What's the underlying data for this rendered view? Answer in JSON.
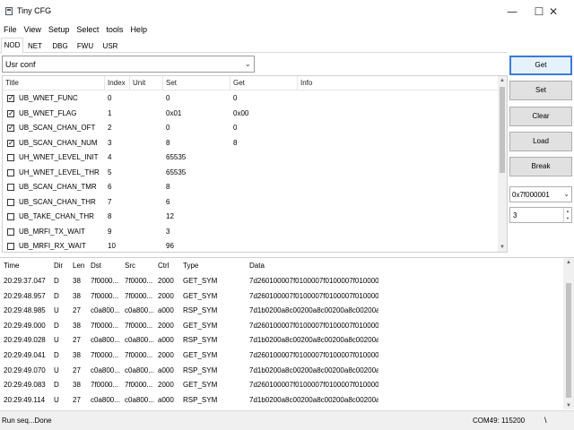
{
  "window": {
    "title": "Tiny CFG",
    "minimize_glyph": "—",
    "maximize_glyph": "☐",
    "close_glyph": "✕"
  },
  "menu": [
    "File",
    "View",
    "Setup",
    "Select",
    "tools",
    "Help"
  ],
  "tabs": [
    {
      "label": "NOD",
      "active": true
    },
    {
      "label": "NET",
      "active": false
    },
    {
      "label": "DBG",
      "active": false
    },
    {
      "label": "FWU",
      "active": false
    },
    {
      "label": "USR",
      "active": false
    }
  ],
  "config_combo": {
    "value": "Usr conf"
  },
  "param_table": {
    "columns": [
      "Title",
      "Index",
      "Unit",
      "Set",
      "Get",
      "Info"
    ],
    "rows": [
      {
        "checked": true,
        "title": "UB_WNET_FUNC",
        "index": "0",
        "unit": "",
        "set": "0",
        "get": "0",
        "info": ""
      },
      {
        "checked": true,
        "title": "UB_WNET_FLAG",
        "index": "1",
        "unit": "",
        "set": "0x01",
        "get": "0x00",
        "info": ""
      },
      {
        "checked": true,
        "title": "UB_SCAN_CHAN_OFT",
        "index": "2",
        "unit": "",
        "set": "0",
        "get": "0",
        "info": ""
      },
      {
        "checked": true,
        "title": "UB_SCAN_CHAN_NUM",
        "index": "3",
        "unit": "",
        "set": "8",
        "get": "8",
        "info": ""
      },
      {
        "checked": false,
        "title": "UH_WNET_LEVEL_INIT",
        "index": "4",
        "unit": "",
        "set": "65535",
        "get": "",
        "info": ""
      },
      {
        "checked": false,
        "title": "UH_WNET_LEVEL_THR",
        "index": "5",
        "unit": "",
        "set": "65535",
        "get": "",
        "info": ""
      },
      {
        "checked": false,
        "title": "UB_SCAN_CHAN_TMR",
        "index": "6",
        "unit": "",
        "set": "8",
        "get": "",
        "info": ""
      },
      {
        "checked": false,
        "title": "UB_SCAN_CHAN_THR",
        "index": "7",
        "unit": "",
        "set": "6",
        "get": "",
        "info": ""
      },
      {
        "checked": false,
        "title": "UB_TAKE_CHAN_THR",
        "index": "8",
        "unit": "",
        "set": "12",
        "get": "",
        "info": ""
      },
      {
        "checked": false,
        "title": "UB_MRFI_TX_WAIT",
        "index": "9",
        "unit": "",
        "set": "3",
        "get": "",
        "info": ""
      },
      {
        "checked": false,
        "title": "UB_MRFI_RX_WAIT",
        "index": "10",
        "unit": "",
        "set": "96",
        "get": "",
        "info": ""
      }
    ]
  },
  "actions": {
    "get": "Get",
    "set": "Set",
    "clear": "Clear",
    "load": "Load",
    "break": "Break",
    "address": "0x7f000001",
    "count": "3"
  },
  "log_table": {
    "columns": [
      "Time",
      "Dir",
      "Len",
      "Dst",
      "Src",
      "Ctrl",
      "Type",
      "Data"
    ],
    "rows": [
      {
        "time": "20:29:37.047",
        "dir": "D",
        "len": "38",
        "dst": "7f0000...",
        "src": "7f0000...",
        "ctrl": "2000",
        "type": "GET_SYM",
        "data": "7d260100007f0100007f0100007f010000..."
      },
      {
        "time": "20:29:48.957",
        "dir": "D",
        "len": "38",
        "dst": "7f0000...",
        "src": "7f0000...",
        "ctrl": "2000",
        "type": "GET_SYM",
        "data": "7d260100007f0100007f0100007f010000..."
      },
      {
        "time": "20:29:48.985",
        "dir": "U",
        "len": "27",
        "dst": "c0a800...",
        "src": "c0a800...",
        "ctrl": "a000",
        "type": "RSP_SYM",
        "data": "7d1b0200a8c00200a8c00200a8c00200a..."
      },
      {
        "time": "20:29:49.000",
        "dir": "D",
        "len": "38",
        "dst": "7f0000...",
        "src": "7f0000...",
        "ctrl": "2000",
        "type": "GET_SYM",
        "data": "7d260100007f0100007f0100007f010000..."
      },
      {
        "time": "20:29:49.028",
        "dir": "U",
        "len": "27",
        "dst": "c0a800...",
        "src": "c0a800...",
        "ctrl": "a000",
        "type": "RSP_SYM",
        "data": "7d1b0200a8c00200a8c00200a8c00200a..."
      },
      {
        "time": "20:29:49.041",
        "dir": "D",
        "len": "38",
        "dst": "7f0000...",
        "src": "7f0000...",
        "ctrl": "2000",
        "type": "GET_SYM",
        "data": "7d260100007f0100007f0100007f010000..."
      },
      {
        "time": "20:29:49.070",
        "dir": "U",
        "len": "27",
        "dst": "c0a800...",
        "src": "c0a800...",
        "ctrl": "a000",
        "type": "RSP_SYM",
        "data": "7d1b0200a8c00200a8c00200a8c00200a..."
      },
      {
        "time": "20:29:49.083",
        "dir": "D",
        "len": "38",
        "dst": "7f0000...",
        "src": "7f0000...",
        "ctrl": "2000",
        "type": "GET_SYM",
        "data": "7d260100007f0100007f0100007f010000..."
      },
      {
        "time": "20:29:49.114",
        "dir": "U",
        "len": "27",
        "dst": "c0a800...",
        "src": "c0a800...",
        "ctrl": "a000",
        "type": "RSP_SYM",
        "data": "7d1b0200a8c00200a8c00200a8c00200a..."
      }
    ]
  },
  "status": {
    "message": "Run seq...Done",
    "port": "COM49: 115200",
    "grip": "\\"
  },
  "colors": {
    "primary_button_border": "#3d7bd6",
    "button_face": "#e1e1e1",
    "status_bar": "#f0f0f0"
  }
}
